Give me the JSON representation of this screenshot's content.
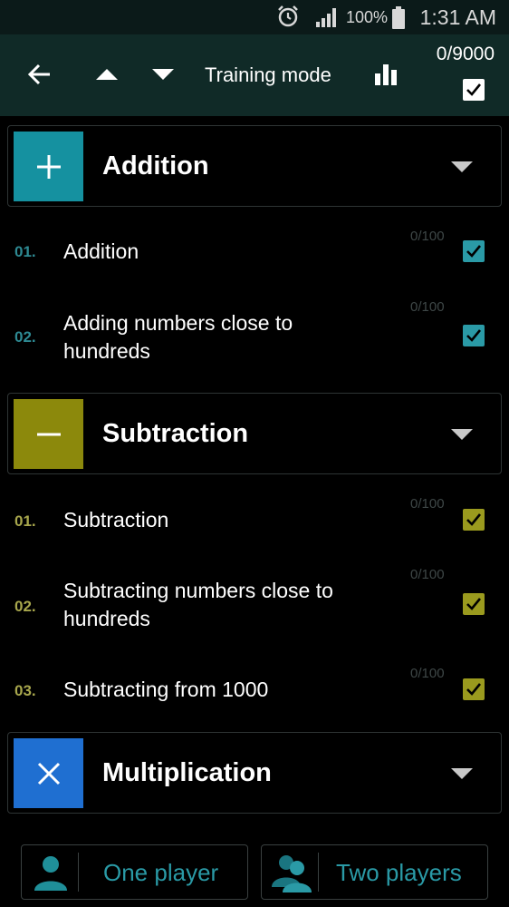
{
  "status_bar": {
    "battery": "100%",
    "time": "1:31 AM"
  },
  "toolbar": {
    "title": "Training mode",
    "counter": "0/9000"
  },
  "sections": [
    {
      "title": "Addition",
      "symbol": "+",
      "color": "#1591a0",
      "items": [
        {
          "num": "01.",
          "label": "Addition",
          "score": "0/100"
        },
        {
          "num": "02.",
          "label": "Adding numbers close to hundreds",
          "score": "0/100"
        }
      ]
    },
    {
      "title": "Subtraction",
      "symbol": "−",
      "color": "#8c890c",
      "items": [
        {
          "num": "01.",
          "label": "Subtraction",
          "score": "0/100"
        },
        {
          "num": "02.",
          "label": "Subtracting numbers close to hundreds",
          "score": "0/100"
        },
        {
          "num": "03.",
          "label": "Subtracting from 1000",
          "score": "0/100"
        }
      ]
    },
    {
      "title": "Multiplication",
      "symbol": "×",
      "color": "#1f6fd1",
      "items": []
    }
  ],
  "bottom": {
    "one_player": "One player",
    "two_players": "Two players"
  }
}
